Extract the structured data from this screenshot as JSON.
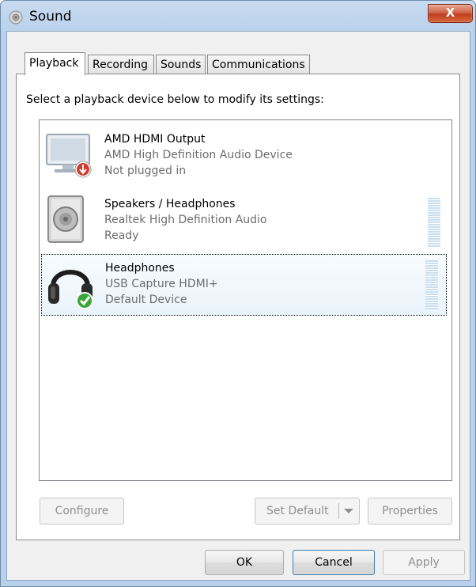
{
  "window": {
    "title": "Sound",
    "close_label": "X"
  },
  "tabs": [
    {
      "label": "Playback",
      "active": true
    },
    {
      "label": "Recording",
      "active": false
    },
    {
      "label": "Sounds",
      "active": false
    },
    {
      "label": "Communications",
      "active": false
    }
  ],
  "playback": {
    "instruction": "Select a playback device below to modify its settings:",
    "devices": [
      {
        "name": "AMD HDMI Output",
        "driver": "AMD High Definition Audio Device",
        "status": "Not plugged in",
        "icon": "monitor-icon",
        "badge": "unplugged-badge-icon",
        "selected": false
      },
      {
        "name": "Speakers / Headphones",
        "driver": "Realtek High Definition Audio",
        "status": "Ready",
        "icon": "speaker-icon",
        "selected": false
      },
      {
        "name": "Headphones",
        "driver": "USB Capture HDMI+",
        "status": "Default Device",
        "icon": "headphones-icon",
        "badge": "default-checkmark-icon",
        "selected": true
      }
    ],
    "buttons": {
      "configure": "Configure",
      "set_default": "Set Default",
      "properties": "Properties"
    }
  },
  "footer": {
    "ok": "OK",
    "cancel": "Cancel",
    "apply": "Apply"
  },
  "colors": {
    "selection": "#eaf4fc",
    "meter": "#c9dff0",
    "close": "#c03e1e"
  }
}
